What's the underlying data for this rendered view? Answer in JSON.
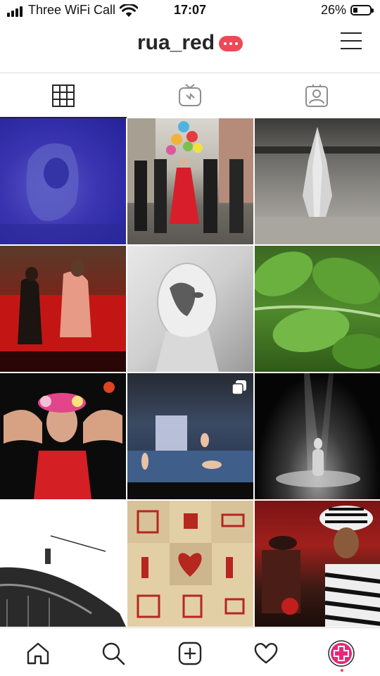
{
  "status_bar": {
    "carrier": "Three WiFi Call",
    "time": "17:07",
    "battery": "26%",
    "battery_level": 0.26
  },
  "header": {
    "username": "rua_red",
    "notification_badge": "ellipsis",
    "menu_icon": "hamburger-icon"
  },
  "tabs": [
    {
      "icon": "grid-icon",
      "active": true
    },
    {
      "icon": "igtv-icon",
      "active": false
    },
    {
      "icon": "tagged-icon",
      "active": false
    }
  ],
  "grid": {
    "posts": [
      {
        "subject": "figure huddled in blue room"
      },
      {
        "subject": "brass band with woman in red dress and balloons"
      },
      {
        "subject": "chrome sculpture in hall"
      },
      {
        "subject": "performers on red sofa"
      },
      {
        "subject": "painted face portrait"
      },
      {
        "subject": "green leaves"
      },
      {
        "subject": "performer with flower crown"
      },
      {
        "subject": "dancers on stage",
        "multiple": true
      },
      {
        "subject": "spotlit figure on stage"
      },
      {
        "subject": "figure on rooftop"
      },
      {
        "subject": "red house and heart prints"
      },
      {
        "subject": "zebra print performer"
      }
    ]
  },
  "bottom_nav": [
    {
      "icon": "home-icon"
    },
    {
      "icon": "search-icon"
    },
    {
      "icon": "new-post-icon"
    },
    {
      "icon": "activity-heart-icon"
    },
    {
      "icon": "profile-icon",
      "active": true
    }
  ],
  "colors": {
    "accent_red": "#ed4956",
    "profile_pink": "#e8277a",
    "divider": "#dbdbdb"
  }
}
